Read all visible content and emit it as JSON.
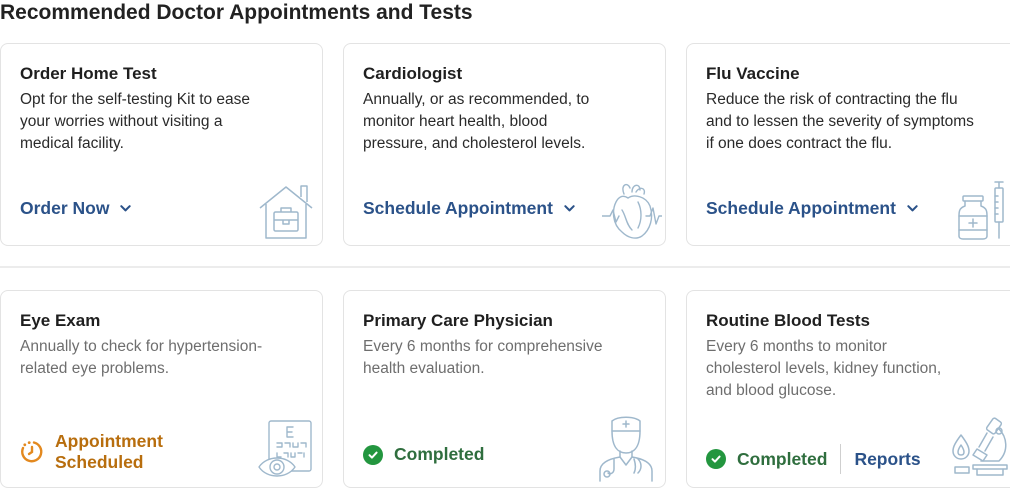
{
  "header": {
    "title": "Recommended Doctor Appointments and Tests"
  },
  "cards_row1": [
    {
      "title": "Order Home Test",
      "desc": [
        "Opt for the self-testing Kit to ease",
        "your worries without visiting a",
        "medical facility."
      ],
      "action": "Order Now",
      "icon": "house-medkit-icon"
    },
    {
      "title": "Cardiologist",
      "desc": [
        "Annually, or as recommended, to",
        "monitor heart health, blood",
        "pressure, and cholesterol levels."
      ],
      "action": "Schedule Appointment",
      "icon": "heart-icon"
    },
    {
      "title": "Flu Vaccine",
      "desc": [
        "Reduce the risk of contracting the flu",
        "and to lessen the severity of symptoms",
        "if one does contract the flu."
      ],
      "action": "Schedule Appointment",
      "icon": "vaccine-icon"
    }
  ],
  "cards_row2": [
    {
      "title": "Eye Exam",
      "desc": [
        "Annually to check for hypertension-",
        "related eye problems."
      ],
      "status": [
        "Appointment",
        "Scheduled"
      ],
      "icon": "eye-chart-icon"
    },
    {
      "title": "Primary Care Physician",
      "desc": [
        "Every 6 months for comprehensive",
        "health evaluation."
      ],
      "status": "Completed",
      "icon": "doctor-icon"
    },
    {
      "title": "Routine Blood Tests",
      "desc": [
        "Every 6 months to monitor",
        "cholesterol levels, kidney function,",
        "and blood glucose."
      ],
      "status": "Completed",
      "link": "Reports",
      "icon": "microscope-icon"
    }
  ],
  "colors": {
    "link": "#2b5289",
    "completed": "#23963f",
    "scheduled": "#b86e0e",
    "icon": "#9fb8cc"
  }
}
